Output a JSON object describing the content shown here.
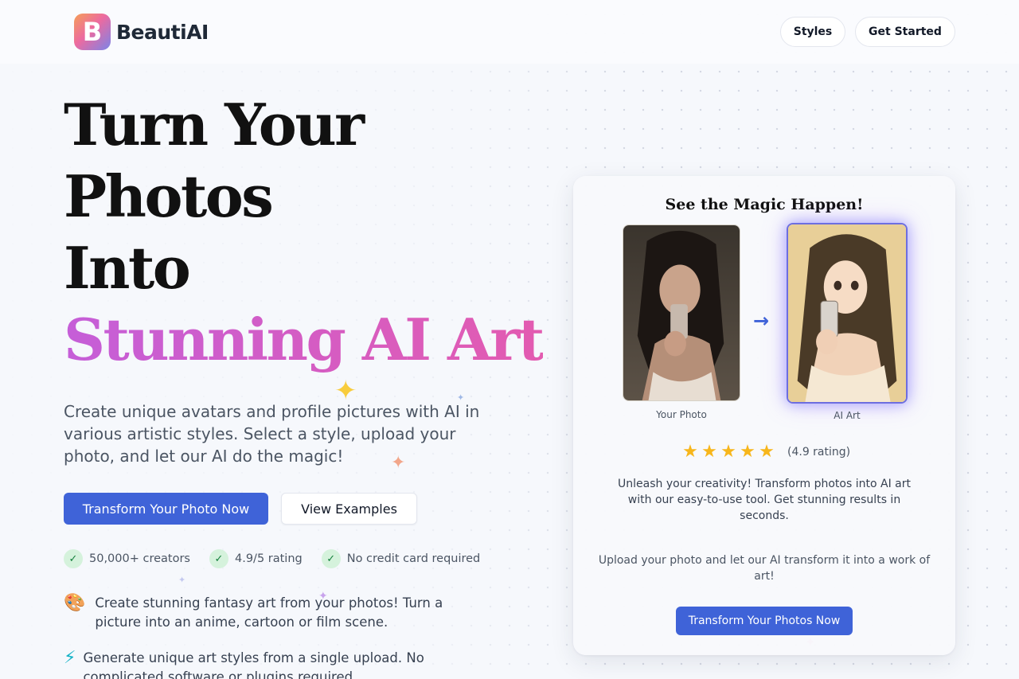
{
  "brand": {
    "logo_letter": "B",
    "name": "BeautiAI"
  },
  "nav": {
    "styles_label": "Styles",
    "get_started_label": "Get Started"
  },
  "hero": {
    "title_lines": [
      "Turn Your",
      "Photos",
      "Into"
    ],
    "title_accent": "Stunning AI Art",
    "description": "Create unique avatars and profile pictures with AI in various artistic styles. Select a style, upload your photo, and let our AI do the magic!",
    "primary_button": "Transform Your Photo Now",
    "secondary_button": "View Examples",
    "checks": [
      "50,000+ creators",
      "4.9/5 rating",
      "No credit card required"
    ],
    "features": [
      {
        "icon": "palette-icon",
        "glyph": "🎨",
        "text": "Create stunning fantasy art from your photos! Turn a picture into an anime, cartoon or film scene."
      },
      {
        "icon": "lightning-icon",
        "glyph": "⚡",
        "text": "Generate unique art styles from a single upload. No complicated software or plugins required."
      }
    ]
  },
  "demo_card": {
    "title": "See the Magic Happen!",
    "before_caption": "Your Photo",
    "after_caption": "AI Art",
    "arrow": "→",
    "stars": 5,
    "rating_text": "(4.9 rating)",
    "description": "Unleash your creativity! Transform photos into AI art with our easy-to-use tool. Get stunning results in seconds.",
    "upload_text": "Upload your photo and let our AI transform it into a work of art!",
    "button": "Transform Your Photos Now"
  },
  "colors": {
    "primary": "#3f63d8",
    "accent_gradient_start": "#c55ed8",
    "accent_gradient_end": "#e35bb0",
    "star": "#f7b61b",
    "check_bg": "#d5f2dc"
  }
}
